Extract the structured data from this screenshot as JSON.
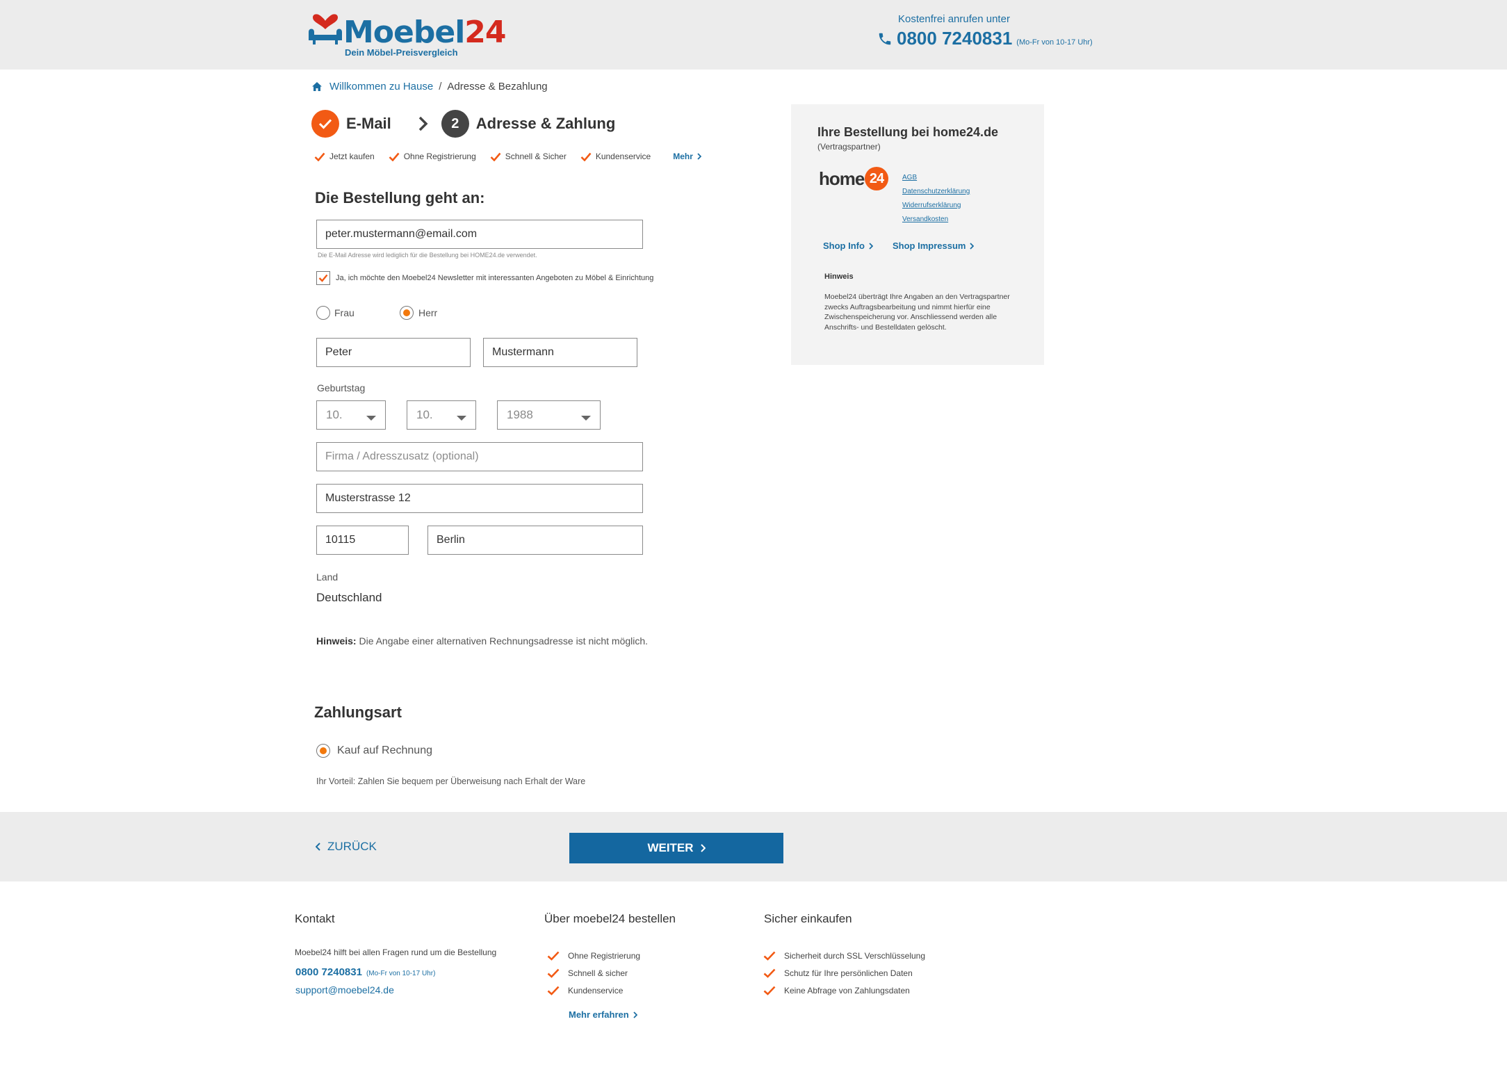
{
  "colors": {
    "brand_blue": "#1c6fa3",
    "brand_red": "#d42a1e",
    "accent_orange": "#f25a14",
    "button_blue": "#1467a0",
    "bar_gray": "#ececec"
  },
  "header": {
    "logo_word_1": "Moebel",
    "logo_word_2": "24",
    "logo_tagline": "Dein Möbel-Preisvergleich",
    "hotline_caption": "Kostenfrei anrufen unter",
    "hotline_number": "0800 7240831",
    "hotline_hours": "(Mo-Fr von 10-17 Uhr)",
    "icons": [
      "sofa-heart-logo-icon",
      "phone-icon"
    ]
  },
  "breadcrumb": {
    "home_label": "Willkommen zu Hause",
    "separator": "/",
    "current": "Adresse & Bezahlung"
  },
  "steps": {
    "step1_label": "E-Mail",
    "step2_number": "2",
    "step2_label": "Adresse & Zahlung"
  },
  "benefits": {
    "items": [
      "Jetzt kaufen",
      "Ohne Registrierung",
      "Schnell & Sicher",
      "Kundenservice"
    ],
    "more_label": "Mehr"
  },
  "form": {
    "title": "Die Bestellung geht an:",
    "email_value": "peter.mustermann@email.com",
    "email_hint": "Die E-Mail Adresse wird lediglich für die Bestellung bei HOME24.de verwendet.",
    "newsletter_label": "Ja, ich möchte den Moebel24 Newsletter mit interessanten Angeboten zu Möbel & Einrichtung",
    "newsletter_checked": true,
    "salutation_frau": "Frau",
    "salutation_herr": "Herr",
    "salutation_selected": "Herr",
    "first_name": "Peter",
    "last_name": "Mustermann",
    "birthday_label": "Geburtstag",
    "birth_day": "10.",
    "birth_month": "10.",
    "birth_year": "1988",
    "company_placeholder": "Firma / Adresszusatz (optional)",
    "street": "Musterstrasse 12",
    "zip": "10115",
    "city": "Berlin",
    "country_label": "Land",
    "country_value": "Deutschland",
    "note_label": "Hinweis:",
    "note_text": "Die Angabe einer alternativen Rechnungsadresse ist nicht möglich."
  },
  "payment": {
    "title": "Zahlungsart",
    "option_label": "Kauf auf Rechnung",
    "option_selected": true,
    "advantage": "Ihr Vorteil: Zahlen Sie bequem per Überweisung nach Erhalt der Ware"
  },
  "sidebar": {
    "title": "Ihre Bestellung bei home24.de",
    "subtitle": "(Vertragspartner)",
    "partner_logo_word": "home",
    "partner_logo_badge": "24",
    "links": [
      "AGB",
      "Datenschutzerklärung",
      "Widerrufserklärung",
      "Versandkosten"
    ],
    "shop_info": "Shop Info",
    "shop_impressum": "Shop Impressum",
    "hint_title": "Hinweis",
    "hint_text": "Moebel24 überträgt Ihre Angaben an den Vertragspartner zwecks Auftragsbearbeitung und nimmt hierfür eine Zwischenspeicherung vor. Anschliessend werden alle Anschrifts- und Bestelldaten gelöscht."
  },
  "actions": {
    "back_label": "ZURÜCK",
    "next_label": "WEITER"
  },
  "footer": {
    "contact_title": "Kontakt",
    "contact_text": "Moebel24 hilft bei allen Fragen rund um die Bestellung",
    "contact_phone": "0800 7240831",
    "contact_hours": "(Mo-Fr von 10-17 Uhr)",
    "contact_email": "support@moebel24.de",
    "order_title": "Über moebel24 bestellen",
    "order_items": [
      "Ohne Registrierung",
      "Schnell & sicher",
      "Kundenservice"
    ],
    "order_more": "Mehr erfahren",
    "secure_title": "Sicher einkaufen",
    "secure_items": [
      "Sicherheit durch SSL Verschlüsselung",
      "Schutz für Ihre persönlichen Daten",
      "Keine Abfrage von Zahlungsdaten"
    ]
  }
}
